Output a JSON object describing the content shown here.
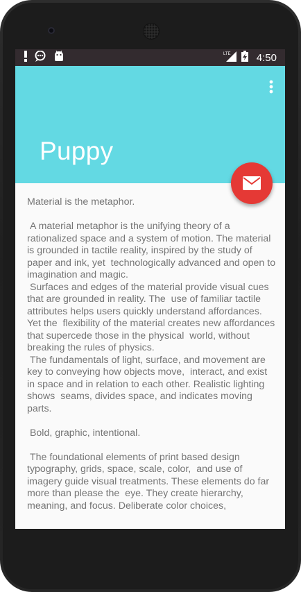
{
  "status_bar": {
    "icons_left": [
      "alert-icon",
      "chat-icon",
      "android-icon"
    ],
    "network_label": "LTE",
    "time": "4:50"
  },
  "app_bar": {
    "title": "Puppy",
    "color": "#63d9e3"
  },
  "fab": {
    "icon": "mail-icon",
    "color": "#e53935"
  },
  "content": {
    "text": "Material is the metaphor.\n\n A material metaphor is the unifying theory of a rationalized space and a system of motion. The material is grounded in tactile reality, inspired by the study of paper and ink, yet  technologically advanced and open to imagination and magic.\n Surfaces and edges of the material provide visual cues that are grounded in reality. The  use of familiar tactile attributes helps users quickly understand affordances. Yet the  flexibility of the material creates new affordances that supercede those in the physical  world, without breaking the rules of physics.\n The fundamentals of light, surface, and movement are key to conveying how objects move,  interact, and exist in space and in relation to each other. Realistic lighting shows  seams, divides space, and indicates moving parts.\n\n Bold, graphic, intentional.\n\n The foundational elements of print based design typography, grids, space, scale, color,  and use of imagery guide visual treatments. These elements do far more than please the  eye. They create hierarchy, meaning, and focus. Deliberate color choices,"
  }
}
